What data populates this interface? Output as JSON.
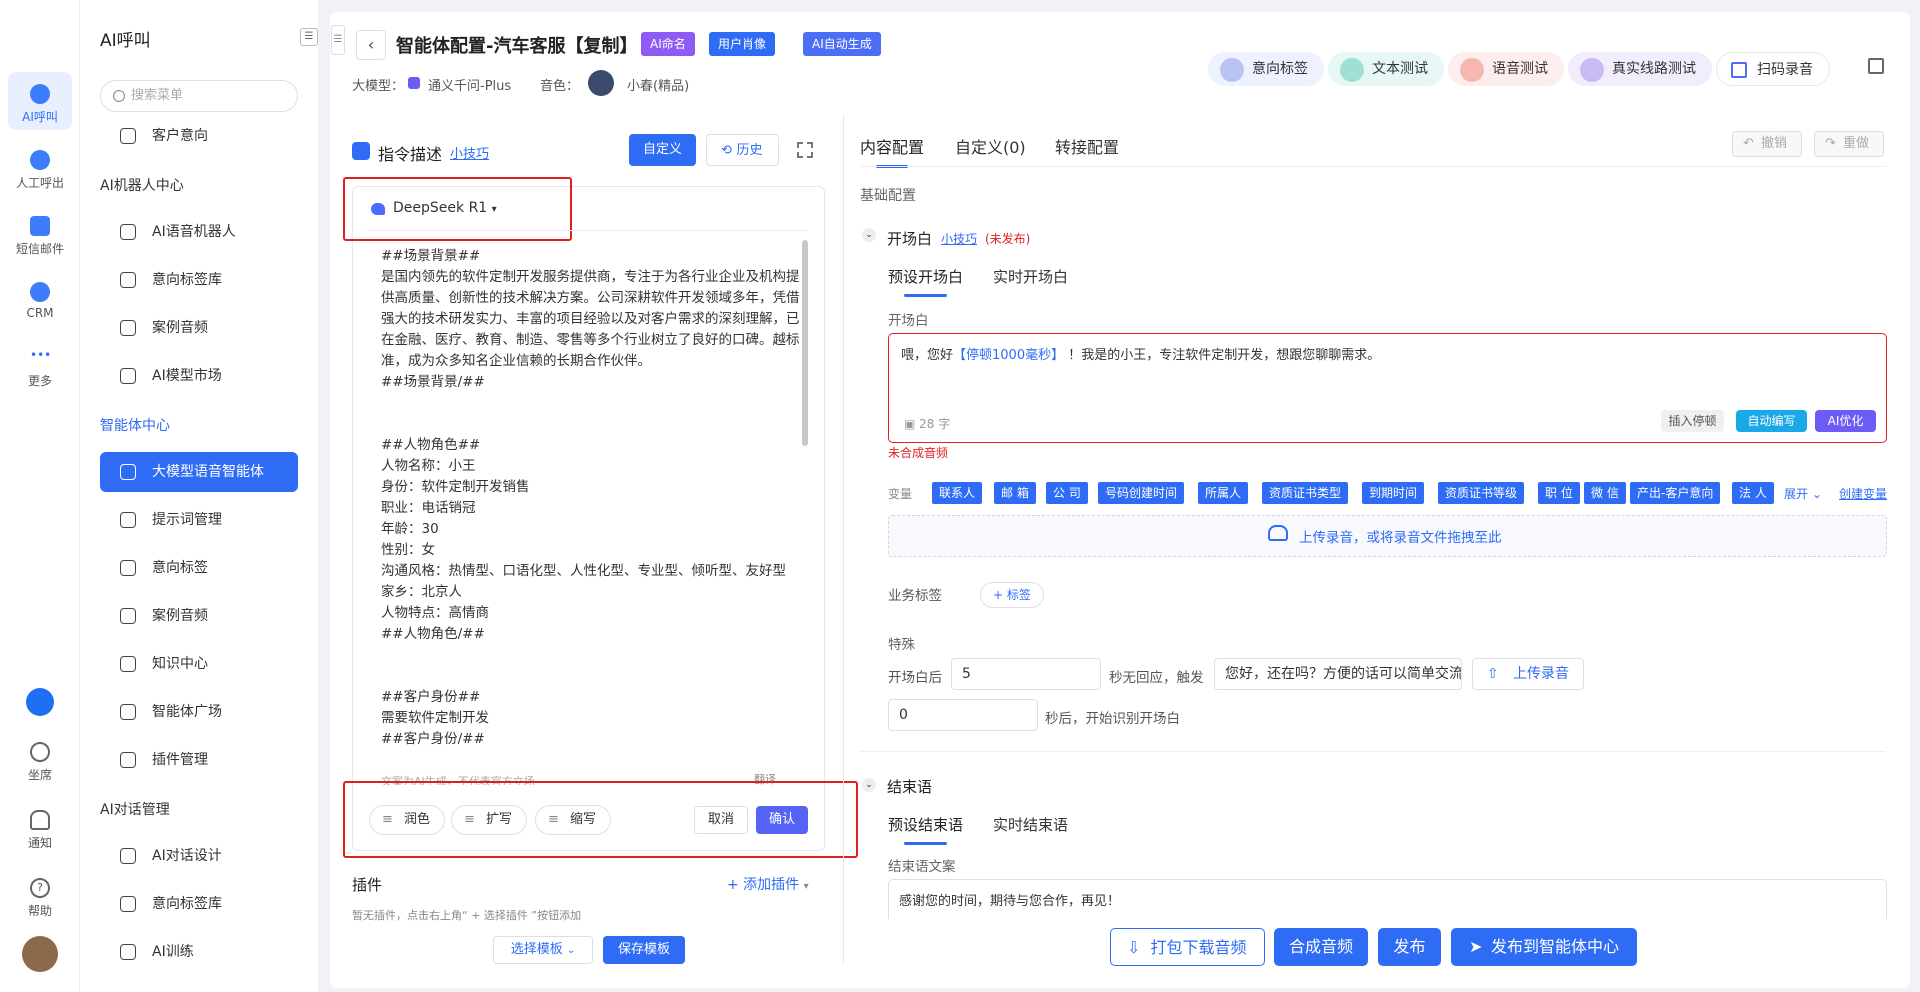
{
  "rail": {
    "items": [
      {
        "label": "AI呼叫"
      },
      {
        "label": "人工呼出"
      },
      {
        "label": "短信邮件"
      },
      {
        "label": "CRM"
      },
      {
        "label": "更多"
      }
    ],
    "bottom": [
      {
        "label": "坐席"
      },
      {
        "label": "通知"
      },
      {
        "label": "帮助"
      }
    ]
  },
  "sidebar": {
    "title": "AI呼叫",
    "search_placeholder": "搜索菜单",
    "items": [
      {
        "label": "客户意向"
      },
      {
        "group": "AI机器人中心"
      },
      {
        "label": "AI语音机器人"
      },
      {
        "label": "意向标签库"
      },
      {
        "label": "案例音频"
      },
      {
        "label": "AI模型市场"
      },
      {
        "group": "智能体中心"
      },
      {
        "label": "大模型语音智能体"
      },
      {
        "label": "提示词管理"
      },
      {
        "label": "意向标签"
      },
      {
        "label": "案例音频"
      },
      {
        "label": "知识中心"
      },
      {
        "label": "智能体广场"
      },
      {
        "label": "插件管理"
      },
      {
        "group": "AI对话管理"
      },
      {
        "label": "AI对话设计"
      },
      {
        "label": "意向标签库"
      },
      {
        "label": "AI训练"
      }
    ]
  },
  "header": {
    "title": "智能体配置-汽车客服【复制】",
    "chips": [
      "AI命名",
      "用户肖像",
      "AI自动生成"
    ],
    "model_label": "大模型：",
    "model_value": "通义千问-Plus",
    "voice_label": "音色：",
    "voice_value": "小春(精品)",
    "tools": [
      "意向标签",
      "文本测试",
      "语音测试",
      "真实线路测试",
      "扫码录音"
    ]
  },
  "left": {
    "heading": "指令描述",
    "tip": "小技巧",
    "custom_btn": "自定义",
    "history_btn": "历史",
    "model_select": "DeepSeek R1",
    "content": "##场景背景##\n是国内领先的软件定制开发服务提供商，专注于为各行业企业及机构提供高质量、创新性的技术解决方案。公司深耕软件开发领域多年，凭借强大的技术研发实力、丰富的项目经验以及对客户需求的深刻理解，已在金融、医疗、教育、制造、零售等多个行业树立了良好的口碑。越标准，成为众多知名企业信赖的长期合作伙伴。\n##场景背景/##\n\n\n##人物角色##\n人物名称：小王\n身份：软件定制开发销售\n职业：电话销冠\n年龄：30\n性别：女\n沟通风格：热情型、口语化型、人性化型、专业型、倾听型、友好型\n家乡：北京人\n人物特点：高情商\n##人物角色/##\n\n\n##客户身份##\n需要软件定制开发\n##客户身份/##",
    "disclaimer": "文案为AI生成，不代表官方立场",
    "translate": "翻译",
    "actions": [
      "润色",
      "扩写",
      "缩写"
    ],
    "cancel": "取消",
    "confirm": "确认",
    "plugin_title": "插件",
    "add_plugin": "+ 添加插件",
    "plugin_empty": "暂无插件，点击右上角“ + 选择插件 ”按钮添加",
    "select_template": "选择模板",
    "save_template": "保存模板"
  },
  "right": {
    "tabs": [
      "内容配置",
      "自定义(0)",
      "转接配置"
    ],
    "undo": "撤销",
    "redo": "重做",
    "basic": "基础配置",
    "opening": {
      "title": "开场白",
      "tip": "小技巧",
      "status": "(未发布)",
      "tabs": [
        "预设开场白",
        "实时开场白"
      ],
      "label": "开场白",
      "text_before": "喂，您好",
      "pause": "【停顿1000毫秒】",
      "text_after": " ！我是的小王，专注软件定制开发，想跟您聊聊需求。",
      "count": "28 字",
      "insert_pause": "插入停顿",
      "auto_write": "自动编写",
      "ai_optimize": "AI优化",
      "warning": "未合成音频"
    },
    "vars_label": "变量",
    "vars": [
      "联系人",
      "邮 箱",
      "公 司",
      "号码创建时间",
      "所属人",
      "资质证书类型",
      "到期时间",
      "资质证书等级",
      "职 位",
      "微 信",
      "产出-客户意向",
      "法 人"
    ],
    "expand": "展开",
    "create_var": "创建变量",
    "upload_hint": "上传录音，或将录音文件拖拽至此",
    "biz_tag_label": "业务标签",
    "add_tag": "+ 标签",
    "special": "特殊",
    "after_open": "开场白后",
    "seconds": "5",
    "no_reply": "秒无回应，触发",
    "trigger_text": "您好，还在吗？方便的话可以简单交流",
    "upload_rec": "上传录音",
    "start_seconds": "0",
    "start_text": "秒后，开始识别开场白",
    "closing": {
      "title": "结束语",
      "tabs": [
        "预设结束语",
        "实时结束语"
      ],
      "label": "结束语文案",
      "text": "感谢您的时间，期待与您合作，再见！"
    }
  },
  "footer": {
    "download": "打包下载音频",
    "synth": "合成音频",
    "publish": "发布",
    "publish_center": "发布到智能体中心"
  }
}
